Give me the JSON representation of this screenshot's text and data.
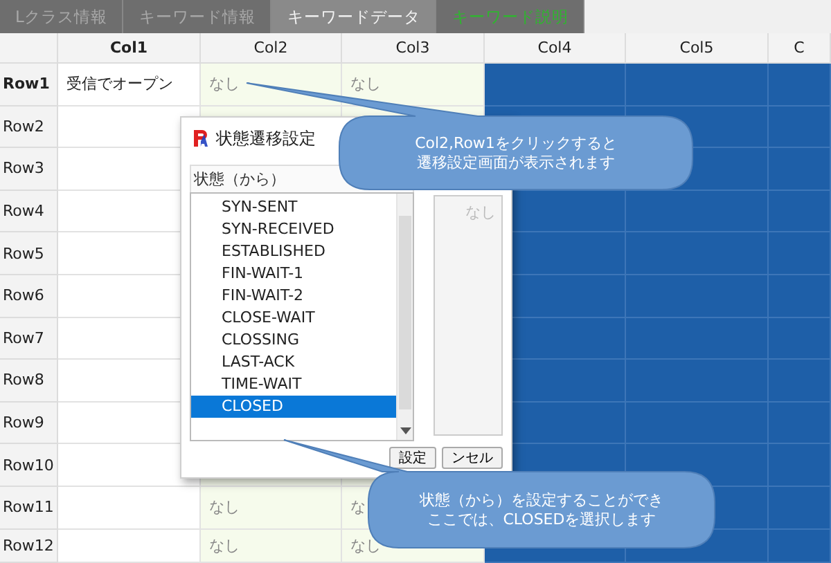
{
  "tabs": [
    {
      "label": "Lクラス情報",
      "selected": false,
      "kind": "plain"
    },
    {
      "label": "キーワード情報",
      "selected": false,
      "kind": "plain"
    },
    {
      "label": "キーワードデータ",
      "selected": true,
      "kind": "plain"
    },
    {
      "label": "キーワード説明",
      "selected": false,
      "kind": "accent"
    }
  ],
  "table": {
    "columns": [
      {
        "label": "Col1",
        "selected": true,
        "kind": "text"
      },
      {
        "label": "Col2",
        "selected": false,
        "kind": "choice"
      },
      {
        "label": "Col3",
        "selected": false,
        "kind": "choice"
      },
      {
        "label": "Col4",
        "selected": false,
        "kind": "highlighted"
      },
      {
        "label": "Col5",
        "selected": false,
        "kind": "highlighted"
      },
      {
        "label": "C",
        "selected": false,
        "kind": "highlighted"
      }
    ],
    "rows": [
      {
        "label": "Row1",
        "selected": true,
        "cells": [
          "受信でオープン",
          "なし",
          "なし"
        ]
      },
      {
        "label": "Row2",
        "selected": false
      },
      {
        "label": "Row3",
        "selected": false
      },
      {
        "label": "Row4",
        "selected": false
      },
      {
        "label": "Row5",
        "selected": false
      },
      {
        "label": "Row6",
        "selected": false
      },
      {
        "label": "Row7",
        "selected": false
      },
      {
        "label": "Row8",
        "selected": false
      },
      {
        "label": "Row9",
        "selected": false
      },
      {
        "label": "Row10",
        "selected": false
      },
      {
        "label": "Row11",
        "selected": false,
        "cells": [
          null,
          "なし",
          "な"
        ]
      },
      {
        "label": "Row12",
        "selected": false,
        "cells": [
          null,
          "なし",
          "なし"
        ]
      }
    ]
  },
  "dialog": {
    "title": "状態遷移設定",
    "list_label": "状態（から）",
    "items": [
      {
        "label": "SYN-SENT",
        "selected": false
      },
      {
        "label": "SYN-RECEIVED",
        "selected": false
      },
      {
        "label": "ESTABLISHED",
        "selected": false
      },
      {
        "label": "FIN-WAIT-1",
        "selected": false
      },
      {
        "label": "FIN-WAIT-2",
        "selected": false
      },
      {
        "label": "CLOSE-WAIT",
        "selected": false
      },
      {
        "label": "CLOSSING",
        "selected": false
      },
      {
        "label": "LAST-ACK",
        "selected": false
      },
      {
        "label": "TIME-WAIT",
        "selected": false
      },
      {
        "label": "CLOSED",
        "selected": true
      }
    ],
    "right_value": "なし",
    "buttons": [
      "設定",
      "ンセル"
    ]
  },
  "callouts": [
    {
      "lines": [
        "Col2,Row1をクリックすると",
        "遷移設定画面が表示されます"
      ]
    },
    {
      "lines": [
        "状態（から）を設定することができ",
        "ここでは、CLOSEDを選択します"
      ]
    }
  ]
}
